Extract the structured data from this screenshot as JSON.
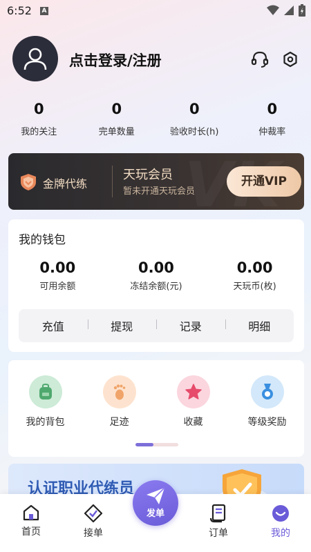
{
  "status_bar": {
    "time": "6:52",
    "badge": "A"
  },
  "profile": {
    "login_text": "点击登录/注册"
  },
  "stats": [
    {
      "value": "0",
      "label": "我的关注"
    },
    {
      "value": "0",
      "label": "完单数量"
    },
    {
      "value": "0",
      "label": "验收时长(h)"
    },
    {
      "value": "0",
      "label": "仲裁率"
    }
  ],
  "vip": {
    "badge_label": "金牌代练",
    "title": "天玩会员",
    "subtitle": "暂未开通天玩会员",
    "button_label": "开通VIP"
  },
  "wallet": {
    "title": "我的钱包",
    "items": [
      {
        "value": "0.00",
        "label": "可用余额"
      },
      {
        "value": "0.00",
        "label": "冻结余额(元)"
      },
      {
        "value": "0.00",
        "label": "天玩币(枚)"
      }
    ],
    "actions": [
      "充值",
      "提现",
      "记录",
      "明细"
    ]
  },
  "features": [
    {
      "label": "我的背包",
      "icon": "backpack-icon",
      "color": "#cdebd7",
      "accent": "#4fa86e"
    },
    {
      "label": "足迹",
      "icon": "footprint-icon",
      "color": "#fde3cf",
      "accent": "#f0a46a"
    },
    {
      "label": "收藏",
      "icon": "star-icon",
      "color": "#fbd6de",
      "accent": "#e64b6b"
    },
    {
      "label": "等级奖励",
      "icon": "medal-icon",
      "color": "#d3e8fa",
      "accent": "#3a8fe0"
    }
  ],
  "pager": {
    "active_fraction": 0.42
  },
  "cert_banner": {
    "text": "认证职业代练员"
  },
  "tabbar": {
    "tabs": [
      "首页",
      "接单",
      "发单",
      "订单",
      "我的"
    ],
    "active": "我的",
    "accent": "#6a5bd8"
  }
}
